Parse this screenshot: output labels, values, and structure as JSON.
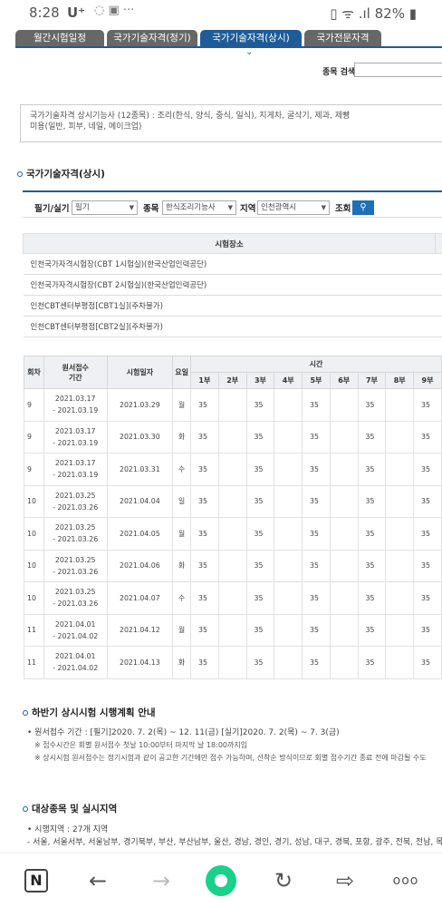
{
  "status": {
    "time": "8:28",
    "carrier": "U⁺",
    "icons": "◌  ▣  ···",
    "right": "▯ ᯤ .ıl 82% ▮"
  },
  "tabs": [
    "월간시험일정",
    "국가기술자격(정기)",
    "국가기술자격(상시)",
    "국가전문자격"
  ],
  "search": {
    "label": "종목 검색",
    "value": ""
  },
  "notice": [
    "국가기술자격 상시기능사 (12종목) : 조리(한식, 양식, 중식, 일식), 지게차, 굴삭기, 제과, 제빵",
    "미용(일반, 피부, 네일, 메이크업)"
  ],
  "section_title": "국가기술자격(상시)",
  "filter": {
    "type_label": "필기/실기",
    "type_value": "필기",
    "subject_label": "종목",
    "subject_value": "한식조리기능사",
    "region_label": "지역",
    "region_value": "인천광역시",
    "query_label": "조회",
    "query_icon": "search-icon"
  },
  "places": {
    "header": "시험장소",
    "rows": [
      "인천국가자격시험장(CBT 1시험실)(한국산업인력공단)",
      "인천국가자격시험장(CBT 2시험실)(한국산업인력공단)",
      "인천CBT센터부평점[CBT1실](주차불가)",
      "인천CBT센터부평점[CBT2실](주차불가)"
    ]
  },
  "schedule": {
    "headers": {
      "round": "회차",
      "apply": "원서접수\n기간",
      "date": "시험일자",
      "day": "요일",
      "time": "시간"
    },
    "sessions": [
      "1부",
      "2부",
      "3부",
      "4부",
      "5부",
      "6부",
      "7부",
      "8부",
      "9부"
    ],
    "rows": [
      {
        "round": "9",
        "apply1": "2021.03.17",
        "apply2": "- 2021.03.19",
        "date": "2021.03.29",
        "day": "월",
        "s": [
          "35",
          "",
          "35",
          "",
          "35",
          "",
          "35",
          "",
          "35"
        ]
      },
      {
        "round": "9",
        "apply1": "2021.03.17",
        "apply2": "- 2021.03.19",
        "date": "2021.03.30",
        "day": "화",
        "s": [
          "35",
          "",
          "35",
          "",
          "35",
          "",
          "35",
          "",
          "35"
        ]
      },
      {
        "round": "9",
        "apply1": "2021.03.17",
        "apply2": "- 2021.03.19",
        "date": "2021.03.31",
        "day": "수",
        "s": [
          "35",
          "",
          "35",
          "",
          "35",
          "",
          "35",
          "",
          "35"
        ]
      },
      {
        "round": "10",
        "apply1": "2021.03.25",
        "apply2": "- 2021.03.26",
        "date": "2021.04.04",
        "day": "일",
        "s": [
          "35",
          "",
          "35",
          "",
          "35",
          "",
          "35",
          "",
          "35"
        ]
      },
      {
        "round": "10",
        "apply1": "2021.03.25",
        "apply2": "- 2021.03.26",
        "date": "2021.04.05",
        "day": "월",
        "s": [
          "35",
          "",
          "35",
          "",
          "35",
          "",
          "35",
          "",
          "35"
        ]
      },
      {
        "round": "10",
        "apply1": "2021.03.25",
        "apply2": "- 2021.03.26",
        "date": "2021.04.06",
        "day": "화",
        "s": [
          "35",
          "",
          "35",
          "",
          "35",
          "",
          "35",
          "",
          "35"
        ]
      },
      {
        "round": "10",
        "apply1": "2021.03.25",
        "apply2": "- 2021.03.26",
        "date": "2021.04.07",
        "day": "수",
        "s": [
          "35",
          "",
          "35",
          "",
          "35",
          "",
          "35",
          "",
          "35"
        ]
      },
      {
        "round": "11",
        "apply1": "2021.04.01",
        "apply2": "- 2021.04.02",
        "date": "2021.04.12",
        "day": "월",
        "s": [
          "35",
          "",
          "35",
          "",
          "35",
          "",
          "35",
          "",
          "35"
        ]
      },
      {
        "round": "11",
        "apply1": "2021.04.01",
        "apply2": "- 2021.04.02",
        "date": "2021.04.13",
        "day": "화",
        "s": [
          "35",
          "",
          "35",
          "",
          "35",
          "",
          "35",
          "",
          "35"
        ]
      }
    ]
  },
  "plan": {
    "title": "하반기 상시시험 시행계획 안내",
    "line1": "• 원서접수 기간 : [필기]2020. 7. 2(목) ~ 12. 11(금) [실기]2020. 7. 2(목) ~ 7. 3(금)",
    "sub1": "※ 접수시간은 회별 원서접수 첫날 10:00부터 마지막 날 18:00까지임",
    "sub2": "※ 상시시험 원서접수는 정기시험과 같이 공고한 기간에만 접수 가능하며, 선착순 방식이므로 회별 접수기간 종료 전에 마감될 수도"
  },
  "target": {
    "title": "대상종목 및 실시지역",
    "line1": "• 시행지역 : 27개 지역",
    "line2": "- 서울, 서울서부, 서울남부, 경기북부, 부산, 부산남부, 울산, 경남, 경인, 경기, 성남, 대구, 경북, 포항, 광주, 전북, 전남, 목포,"
  },
  "navbar": {
    "n": "N",
    "back": "←",
    "forward": "→",
    "refresh": "↻",
    "share": "⇨",
    "more": "ooo"
  }
}
